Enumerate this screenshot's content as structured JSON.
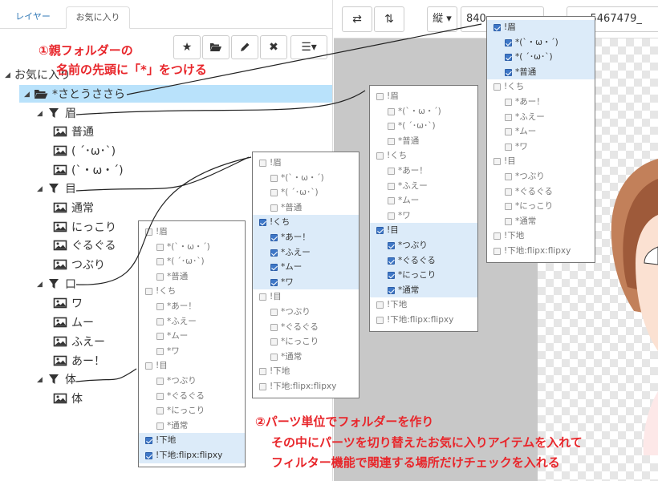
{
  "tabs": {
    "layer": "レイヤー",
    "favorites": "お気に入り"
  },
  "toolbar": {
    "star": "★",
    "folder": "folder-open-icon",
    "pencil": "pencil-icon",
    "delete": "✖",
    "menu": "☰▾"
  },
  "tree": {
    "root": "お気に入り",
    "items": [
      {
        "label": "*さとうささら",
        "depth": 1,
        "icon": "folder-open-icon",
        "selected": true
      },
      {
        "label": "眉",
        "depth": 2,
        "icon": "filter-icon"
      },
      {
        "label": "普通",
        "depth": 3,
        "icon": "image-icon"
      },
      {
        "label": "( ´･ω･`)",
        "depth": 3,
        "icon": "image-icon"
      },
      {
        "label": "(`・ω・´)",
        "depth": 3,
        "icon": "image-icon"
      },
      {
        "label": "目",
        "depth": 2,
        "icon": "filter-icon"
      },
      {
        "label": "通常",
        "depth": 3,
        "icon": "image-icon"
      },
      {
        "label": "にっこり",
        "depth": 3,
        "icon": "image-icon"
      },
      {
        "label": "ぐるぐる",
        "depth": 3,
        "icon": "image-icon"
      },
      {
        "label": "つぶり",
        "depth": 3,
        "icon": "image-icon"
      },
      {
        "label": "口",
        "depth": 2,
        "icon": "filter-icon"
      },
      {
        "label": "ワ",
        "depth": 3,
        "icon": "image-icon"
      },
      {
        "label": "ムー",
        "depth": 3,
        "icon": "image-icon"
      },
      {
        "label": "ふえー",
        "depth": 3,
        "icon": "image-icon"
      },
      {
        "label": "あー！",
        "depth": 3,
        "icon": "image-icon"
      },
      {
        "label": "体",
        "depth": 2,
        "icon": "filter-icon"
      },
      {
        "label": "体",
        "depth": 3,
        "icon": "image-icon"
      }
    ]
  },
  "right_toolbar": {
    "swap_h": "⇄",
    "swap_v": "⇅",
    "orientation": "縦 ▾",
    "width": "840",
    "filename": "_5467479_"
  },
  "annotations": {
    "one_line1": "①親フォルダーの",
    "one_line2": "名前の先頭に「*」をつける",
    "two_line1": "②パーツ単位でフォルダーを作り",
    "two_line2": "その中にパーツを切り替えたお気に入りアイテムを入れて",
    "two_line3": "フィルター機能で関連する場所だけチェックを入れる"
  },
  "boxes": [
    {
      "name": "filter-box-body",
      "rows": [
        {
          "label": "!眉",
          "indent": 0,
          "checked": false,
          "hl": false
        },
        {
          "label": "*(`・ω・´)",
          "indent": 1,
          "checked": false,
          "hl": false
        },
        {
          "label": "*( ´･ω･`)",
          "indent": 1,
          "checked": false,
          "hl": false
        },
        {
          "label": "*普通",
          "indent": 1,
          "checked": false,
          "hl": false
        },
        {
          "label": "!くち",
          "indent": 0,
          "checked": false,
          "hl": false
        },
        {
          "label": "*あー！",
          "indent": 1,
          "checked": false,
          "hl": false
        },
        {
          "label": "*ふえー",
          "indent": 1,
          "checked": false,
          "hl": false
        },
        {
          "label": "*ムー",
          "indent": 1,
          "checked": false,
          "hl": false
        },
        {
          "label": "*ワ",
          "indent": 1,
          "checked": false,
          "hl": false
        },
        {
          "label": "!目",
          "indent": 0,
          "checked": false,
          "hl": false
        },
        {
          "label": "*つぶり",
          "indent": 1,
          "checked": false,
          "hl": false
        },
        {
          "label": "*ぐるぐる",
          "indent": 1,
          "checked": false,
          "hl": false
        },
        {
          "label": "*にっこり",
          "indent": 1,
          "checked": false,
          "hl": false
        },
        {
          "label": "*通常",
          "indent": 1,
          "checked": false,
          "hl": false
        },
        {
          "label": "!下地",
          "indent": 0,
          "checked": true,
          "hl": true
        },
        {
          "label": "!下地:flipx:flipxy",
          "indent": 0,
          "checked": true,
          "hl": true
        }
      ]
    },
    {
      "name": "filter-box-mouth",
      "rows": [
        {
          "label": "!眉",
          "indent": 0,
          "checked": false,
          "hl": false
        },
        {
          "label": "*(`・ω・´)",
          "indent": 1,
          "checked": false,
          "hl": false
        },
        {
          "label": "*( ´･ω･`)",
          "indent": 1,
          "checked": false,
          "hl": false
        },
        {
          "label": "*普通",
          "indent": 1,
          "checked": false,
          "hl": false
        },
        {
          "label": "!くち",
          "indent": 0,
          "checked": true,
          "hl": true
        },
        {
          "label": "*あー！",
          "indent": 1,
          "checked": true,
          "hl": true
        },
        {
          "label": "*ふえー",
          "indent": 1,
          "checked": true,
          "hl": true
        },
        {
          "label": "*ムー",
          "indent": 1,
          "checked": true,
          "hl": true
        },
        {
          "label": "*ワ",
          "indent": 1,
          "checked": true,
          "hl": true
        },
        {
          "label": "!目",
          "indent": 0,
          "checked": false,
          "hl": false
        },
        {
          "label": "*つぶり",
          "indent": 1,
          "checked": false,
          "hl": false
        },
        {
          "label": "*ぐるぐる",
          "indent": 1,
          "checked": false,
          "hl": false
        },
        {
          "label": "*にっこり",
          "indent": 1,
          "checked": false,
          "hl": false
        },
        {
          "label": "*通常",
          "indent": 1,
          "checked": false,
          "hl": false
        },
        {
          "label": "!下地",
          "indent": 0,
          "checked": false,
          "hl": false
        },
        {
          "label": "!下地:flipx:flipxy",
          "indent": 0,
          "checked": false,
          "hl": false
        }
      ]
    },
    {
      "name": "filter-box-eyes",
      "rows": [
        {
          "label": "!眉",
          "indent": 0,
          "checked": false,
          "hl": false
        },
        {
          "label": "*(`・ω・´)",
          "indent": 1,
          "checked": false,
          "hl": false
        },
        {
          "label": "*( ´･ω･`)",
          "indent": 1,
          "checked": false,
          "hl": false
        },
        {
          "label": "*普通",
          "indent": 1,
          "checked": false,
          "hl": false
        },
        {
          "label": "!くち",
          "indent": 0,
          "checked": false,
          "hl": false
        },
        {
          "label": "*あー！",
          "indent": 1,
          "checked": false,
          "hl": false
        },
        {
          "label": "*ふえー",
          "indent": 1,
          "checked": false,
          "hl": false
        },
        {
          "label": "*ムー",
          "indent": 1,
          "checked": false,
          "hl": false
        },
        {
          "label": "*ワ",
          "indent": 1,
          "checked": false,
          "hl": false
        },
        {
          "label": "!目",
          "indent": 0,
          "checked": true,
          "hl": true
        },
        {
          "label": "*つぶり",
          "indent": 1,
          "checked": true,
          "hl": true
        },
        {
          "label": "*ぐるぐる",
          "indent": 1,
          "checked": true,
          "hl": true
        },
        {
          "label": "*にっこり",
          "indent": 1,
          "checked": true,
          "hl": true
        },
        {
          "label": "*通常",
          "indent": 1,
          "checked": true,
          "hl": true
        },
        {
          "label": "!下地",
          "indent": 0,
          "checked": false,
          "hl": false
        },
        {
          "label": "!下地:flipx:flipxy",
          "indent": 0,
          "checked": false,
          "hl": false
        }
      ]
    },
    {
      "name": "filter-box-brows",
      "rows": [
        {
          "label": "!眉",
          "indent": 0,
          "checked": true,
          "hl": true
        },
        {
          "label": "*(`・ω・´)",
          "indent": 1,
          "checked": true,
          "hl": true
        },
        {
          "label": "*( ´･ω･`)",
          "indent": 1,
          "checked": true,
          "hl": true
        },
        {
          "label": "*普通",
          "indent": 1,
          "checked": true,
          "hl": true
        },
        {
          "label": "!くち",
          "indent": 0,
          "checked": false,
          "hl": false
        },
        {
          "label": "*あー！",
          "indent": 1,
          "checked": false,
          "hl": false
        },
        {
          "label": "*ふえー",
          "indent": 1,
          "checked": false,
          "hl": false
        },
        {
          "label": "*ムー",
          "indent": 1,
          "checked": false,
          "hl": false
        },
        {
          "label": "*ワ",
          "indent": 1,
          "checked": false,
          "hl": false
        },
        {
          "label": "!目",
          "indent": 0,
          "checked": false,
          "hl": false
        },
        {
          "label": "*つぶり",
          "indent": 1,
          "checked": false,
          "hl": false
        },
        {
          "label": "*ぐるぐる",
          "indent": 1,
          "checked": false,
          "hl": false
        },
        {
          "label": "*にっこり",
          "indent": 1,
          "checked": false,
          "hl": false
        },
        {
          "label": "*通常",
          "indent": 1,
          "checked": false,
          "hl": false
        },
        {
          "label": "!下地",
          "indent": 0,
          "checked": false,
          "hl": false
        },
        {
          "label": "!下地:flipx:flipxy",
          "indent": 0,
          "checked": false,
          "hl": false
        }
      ]
    }
  ],
  "colors": {
    "accent": "#e8262b",
    "selected_row": "#b9e2fb",
    "highlight": "#dcebf9",
    "checked": "#3e77c7"
  }
}
